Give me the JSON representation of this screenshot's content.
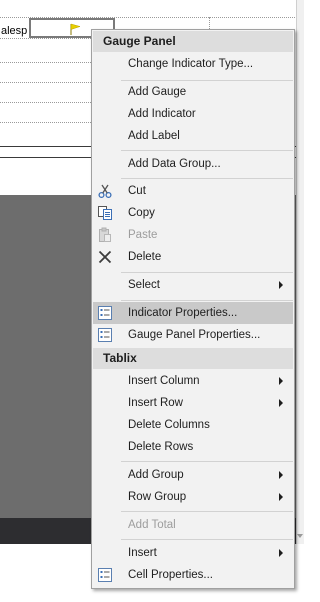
{
  "background": {
    "cell_text": "alesp",
    "colors": {
      "design_surface": "#ffffff",
      "gray_area": "#6d6d6d",
      "dark_bar": "#2d2d30",
      "flag": "#e8d000"
    }
  },
  "menu": {
    "sections": {
      "gauge_panel": "Gauge Panel",
      "tablix": "Tablix"
    },
    "items": {
      "change_indicator_type": "Change Indicator Type...",
      "add_gauge": "Add Gauge",
      "add_indicator": "Add Indicator",
      "add_label": "Add Label",
      "add_data_group": "Add Data Group...",
      "cut": "Cut",
      "copy": "Copy",
      "paste": "Paste",
      "delete": "Delete",
      "select": "Select",
      "indicator_properties": "Indicator Properties...",
      "gauge_panel_properties": "Gauge Panel Properties...",
      "insert_column": "Insert Column",
      "insert_row": "Insert Row",
      "delete_columns": "Delete Columns",
      "delete_rows": "Delete Rows",
      "add_group": "Add Group",
      "row_group": "Row Group",
      "add_total": "Add Total",
      "insert": "Insert",
      "cell_properties": "Cell Properties..."
    },
    "highlighted_item": "Indicator Properties...",
    "disabled_items": [
      "Paste",
      "Add Total"
    ],
    "icons": {
      "cut": "scissors-icon",
      "copy": "copy-icon",
      "paste": "paste-icon",
      "delete": "delete-x-icon",
      "indicator_properties": "properties-icon",
      "gauge_panel_properties": "properties-icon",
      "cell_properties": "properties-icon"
    }
  }
}
